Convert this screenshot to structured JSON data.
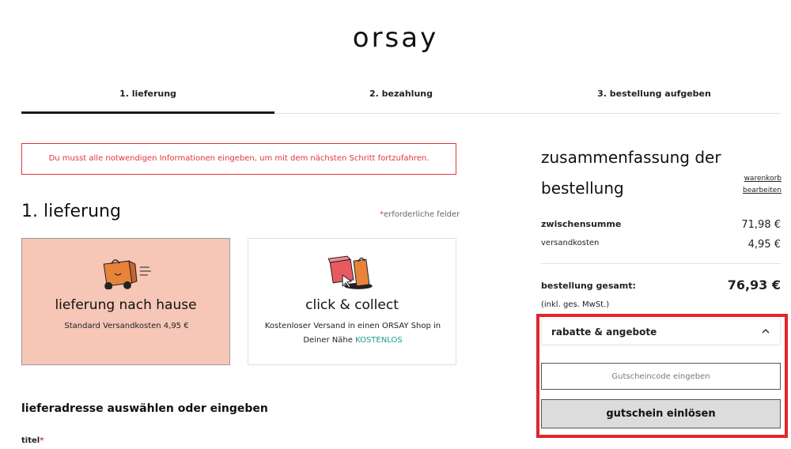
{
  "header": {
    "logo": "orsay"
  },
  "steps": [
    {
      "label": "1. lieferung",
      "active": true
    },
    {
      "label": "2. bezahlung",
      "active": false
    },
    {
      "label": "3. bestellung aufgeben",
      "active": false
    }
  ],
  "error": {
    "message": "Du musst alle notwendigen Informationen eingeben, um mit dem nächsten Schritt fortzufahren."
  },
  "delivery": {
    "section_title": "1. lieferung",
    "required_star": "*",
    "required_label": "erforderliche felder",
    "options": [
      {
        "title": "lieferung nach hause",
        "subtitle": "Standard Versandkosten 4,95 €",
        "icon": "delivery-truck-bag-icon",
        "selected": true
      },
      {
        "title": "click & collect",
        "subtitle": "Kostenloser Versand in einen ORSAY Shop in Deiner Nähe",
        "highlight": "KOSTENLOS",
        "icon": "store-pickup-icon",
        "selected": false
      }
    ],
    "address_title": "lieferadresse auswählen oder eingeben",
    "titel_label": "titel",
    "titel_star": "*"
  },
  "summary": {
    "title": "zusammenfassung der bestellung",
    "edit_link": "warenkorb bearbeiten",
    "subtotal_label": "zwischensumme",
    "subtotal_value": "71,98 €",
    "shipping_label": "versandkosten",
    "shipping_value": "4,95 €",
    "total_label": "bestellung gesamt:",
    "total_value": "76,93 €",
    "vat_note": "(inkl. ges. MwSt.)",
    "discounts": {
      "label": "rabatte & angebote",
      "expanded": true,
      "input_placeholder": "Gutscheincode eingeben",
      "redeem_label": "gutschein einlösen"
    }
  },
  "colors": {
    "accent_red": "#e3343a",
    "selected_card": "#f6c6b7",
    "free_green": "#1c9b8a",
    "icon_orange": "#e8833a"
  }
}
